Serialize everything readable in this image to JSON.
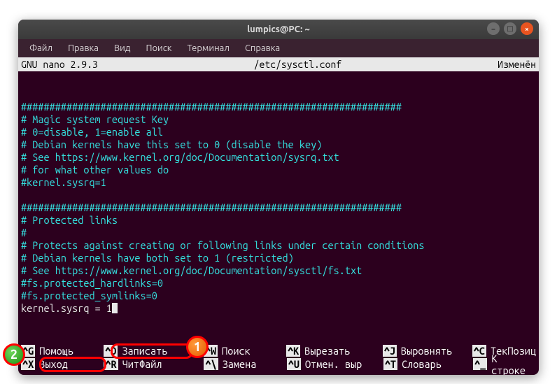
{
  "titlebar": {
    "title": "lumpics@PC: ~"
  },
  "menu": {
    "file": "Файл",
    "edit": "Правка",
    "view": "Вид",
    "search": "Поиск",
    "terminal": "Терминал",
    "help": "Справка"
  },
  "nano": {
    "version": "GNU nano 2.9.3",
    "filepath": "/etc/sysctl.conf",
    "status": "Изменён"
  },
  "content": {
    "line01": "###################################################################",
    "line02": "# Magic system request Key",
    "line03": "# 0=disable, 1=enable all",
    "line04": "# Debian kernels have this set to 0 (disable the key)",
    "line05": "# See https://www.kernel.org/doc/Documentation/sysrq.txt",
    "line06": "# for what other values do",
    "line07": "#kernel.sysrq=1",
    "line08": "",
    "line09": "###################################################################",
    "line10": "# Protected links",
    "line11": "#",
    "line12": "# Protects against creating or following links under certain conditions",
    "line13": "# Debian kernels have both set to 1 (restricted)",
    "line14": "# See https://www.kernel.org/doc/Documentation/sysctl/fs.txt",
    "line15": "#fs.protected_hardlinks=0",
    "line16": "#fs.protected_symlinks=0",
    "line17": "kernel.sysrq = 1"
  },
  "shortcuts": {
    "row1": {
      "help": {
        "key": "^G",
        "label": "Помощь"
      },
      "write": {
        "key": "^O",
        "label": "Записать"
      },
      "search": {
        "key": "^W",
        "label": "Поиск"
      },
      "cut": {
        "key": "^K",
        "label": "Вырезать"
      },
      "justify": {
        "key": "^J",
        "label": "Выровнять"
      },
      "curpos": {
        "key": "^C",
        "label": "ТекПозиц"
      }
    },
    "row2": {
      "exit": {
        "key": "^X",
        "label": "Выход"
      },
      "read": {
        "key": "^R",
        "label": "ЧитФайл"
      },
      "replace": {
        "key": "^\\",
        "label": "Замена"
      },
      "uncut": {
        "key": "^U",
        "label": "Отмен. выр"
      },
      "spell": {
        "key": "^T",
        "label": "Словарь"
      },
      "goto": {
        "key": "^_",
        "label": "К строке"
      }
    }
  },
  "callouts": {
    "one": "1",
    "two": "2"
  }
}
